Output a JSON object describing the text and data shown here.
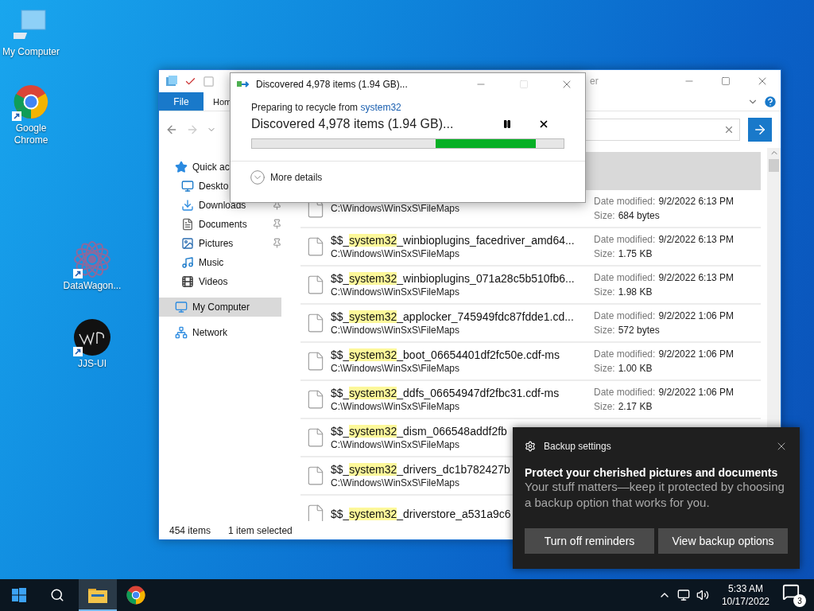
{
  "desktop_icons": [
    {
      "label": "My Computer",
      "kind": "computer",
      "shortcut": false
    },
    {
      "label": "Google Chrome",
      "kind": "chrome",
      "shortcut": true
    },
    {
      "label": "DataWagon...",
      "kind": "flower",
      "shortcut": true
    },
    {
      "label": "JJS-UI",
      "kind": "badge",
      "shortcut": true
    }
  ],
  "explorer": {
    "title": "er",
    "ribbon_tabs": [
      {
        "label": "File",
        "kind": "file"
      },
      {
        "label": "Hom",
        "kind": "tab"
      }
    ],
    "nav": [
      {
        "label": "Quick ac",
        "kind": "star",
        "pinned": false,
        "selected": false,
        "children": [
          {
            "label": "Deskto",
            "kind": "desktop",
            "pinned": false,
            "selected": false
          },
          {
            "label": "Downloads",
            "kind": "download",
            "pinned": true,
            "selected": false
          },
          {
            "label": "Documents",
            "kind": "document",
            "pinned": true,
            "selected": false
          },
          {
            "label": "Pictures",
            "kind": "pictures",
            "pinned": true,
            "selected": false
          },
          {
            "label": "Music",
            "kind": "music",
            "pinned": false,
            "selected": false
          },
          {
            "label": "Videos",
            "kind": "videos",
            "pinned": false,
            "selected": false
          }
        ]
      },
      {
        "label": "My Computer",
        "kind": "computer",
        "pinned": false,
        "selected": true
      },
      {
        "label": "Network",
        "kind": "network",
        "pinned": false,
        "selected": false
      }
    ],
    "files": [
      {
        "selected": true
      },
      {
        "selected": false,
        "path": "C:\\Windows\\WinSxS\\FileMaps",
        "date_label": "Date modified:",
        "date": "9/2/2022 6:13 PM",
        "size_label": "Size:",
        "size": "684 bytes"
      },
      {
        "selected": false,
        "prefix": "$$_",
        "match": "system32",
        "rest": "_winbioplugins_facedriver_amd64...",
        "path": "C:\\Windows\\WinSxS\\FileMaps",
        "date_label": "Date modified:",
        "date": "9/2/2022 6:13 PM",
        "size_label": "Size:",
        "size": "1.75 KB"
      },
      {
        "selected": false,
        "prefix": "$$_",
        "match": "system32",
        "rest": "_winbioplugins_071a28c5b510fb6...",
        "path": "C:\\Windows\\WinSxS\\FileMaps",
        "date_label": "Date modified:",
        "date": "9/2/2022 6:13 PM",
        "size_label": "Size:",
        "size": "1.98 KB"
      },
      {
        "selected": false,
        "prefix": "$$_",
        "match": "system32",
        "rest": "_applocker_745949fdc87fdde1.cd...",
        "path": "C:\\Windows\\WinSxS\\FileMaps",
        "date_label": "Date modified:",
        "date": "9/2/2022 1:06 PM",
        "size_label": "Size:",
        "size": "572 bytes"
      },
      {
        "selected": false,
        "prefix": "$$_",
        "match": "system32",
        "rest": "_boot_06654401df2fc50e.cdf-ms",
        "path": "C:\\Windows\\WinSxS\\FileMaps",
        "date_label": "Date modified:",
        "date": "9/2/2022 1:06 PM",
        "size_label": "Size:",
        "size": "1.00 KB"
      },
      {
        "selected": false,
        "prefix": "$$_",
        "match": "system32",
        "rest": "_ddfs_06654947df2fbc31.cdf-ms",
        "path": "C:\\Windows\\WinSxS\\FileMaps",
        "date_label": "Date modified:",
        "date": "9/2/2022 1:06 PM",
        "size_label": "Size:",
        "size": "2.17 KB"
      },
      {
        "selected": false,
        "prefix": "$$_",
        "match": "system32",
        "rest": "_dism_066548addf2fb",
        "path": "C:\\Windows\\WinSxS\\FileMaps"
      },
      {
        "selected": false,
        "prefix": "$$_",
        "match": "system32",
        "rest": "_drivers_dc1b782427b",
        "path": "C:\\Windows\\WinSxS\\FileMaps"
      },
      {
        "selected": false,
        "prefix": "$$_",
        "match": "system32",
        "rest": "_driverstore_a531a9c6"
      }
    ],
    "status": [
      "454 items",
      "1 item selected"
    ]
  },
  "dialog": {
    "title": "Discovered 4,978 items (1.94 GB)...",
    "maximize_disabled": true,
    "from_label": "Preparing to recycle from ",
    "from_link": "system32",
    "heading": "Discovered 4,978 items (1.94 GB)...",
    "details": "More details"
  },
  "toast": {
    "app": "Backup settings",
    "title": "Protect your cherished pictures and documents",
    "body": "Your stuff matters—keep it protected by choosing a backup option that works for you.",
    "buttons": [
      "Turn off reminders",
      "View backup options"
    ]
  },
  "taskbar": {
    "apps": [
      {
        "kind": "start",
        "active": false
      },
      {
        "kind": "search",
        "active": false
      },
      {
        "kind": "explorer",
        "active": true
      },
      {
        "kind": "chrome",
        "active": false
      }
    ],
    "time": "5:33 AM",
    "date": "10/17/2022",
    "notifications": "3"
  }
}
